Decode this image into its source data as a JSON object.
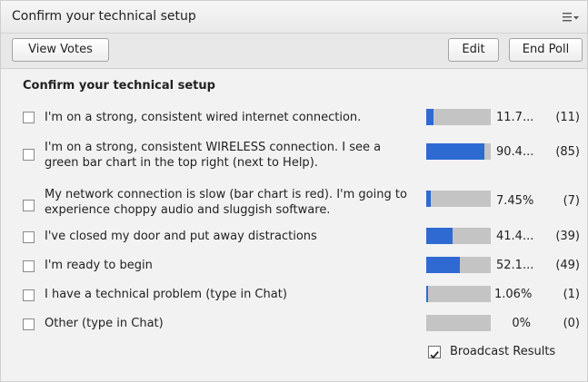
{
  "window": {
    "title": "Confirm your technical setup",
    "menu_icon": "menu-icon"
  },
  "toolbar": {
    "view_votes_label": "View Votes",
    "edit_label": "Edit",
    "end_poll_label": "End Poll"
  },
  "poll": {
    "question": "Confirm your technical setup",
    "bar_color": "#2e6ad2",
    "track_color": "#c4c4c4",
    "options": [
      {
        "text": "I'm on a strong, consistent wired internet connection.",
        "percent_display": "11.7...",
        "count_display": "(11)",
        "fraction": 0.117
      },
      {
        "text": "I'm on a strong, consistent WIRELESS connection. I see a green bar chart in the top right (next to Help).",
        "percent_display": "90.4...",
        "count_display": "(85)",
        "fraction": 0.904
      },
      {
        "text": "My network connection is slow (bar chart is red).  I'm going to experience choppy audio and sluggish software.",
        "percent_display": "7.45%",
        "count_display": "(7)",
        "fraction": 0.0745
      },
      {
        "text": "I've closed my door and put away distractions",
        "percent_display": "41.4...",
        "count_display": "(39)",
        "fraction": 0.414
      },
      {
        "text": "I'm ready to begin",
        "percent_display": "52.1...",
        "count_display": "(49)",
        "fraction": 0.521
      },
      {
        "text": "I have a technical problem (type in Chat)",
        "percent_display": "1.06%",
        "count_display": "(1)",
        "fraction": 0.0106
      },
      {
        "text": "Other (type in Chat)",
        "percent_display": "0%",
        "count_display": "(0)",
        "fraction": 0
      }
    ]
  },
  "broadcast": {
    "label": "Broadcast Results",
    "checked": true
  }
}
